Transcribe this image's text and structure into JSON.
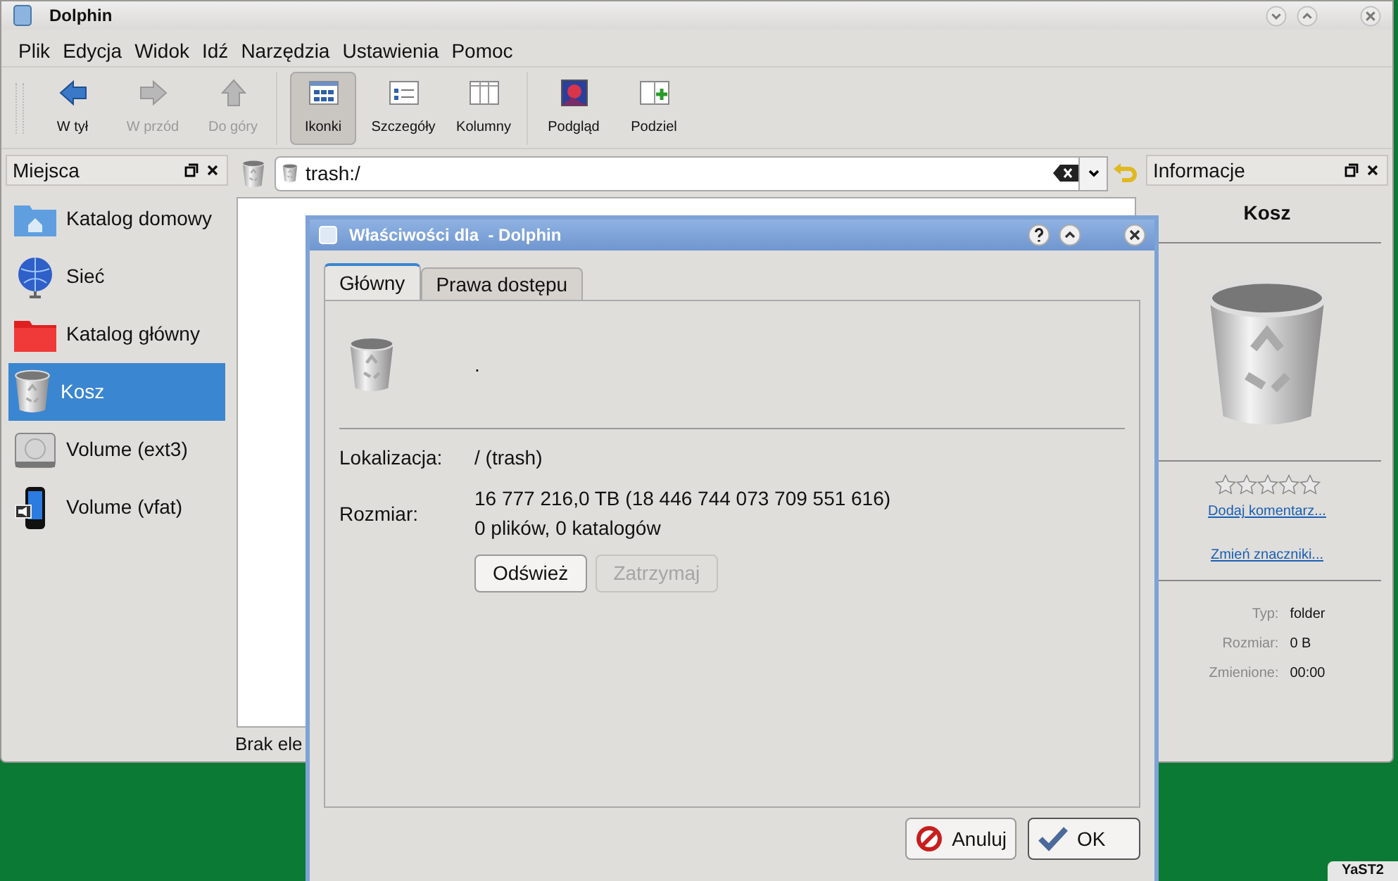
{
  "window": {
    "title": "Dolphin"
  },
  "menu": [
    "Plik",
    "Edycja",
    "Widok",
    "Idź",
    "Narzędzia",
    "Ustawienia",
    "Pomoc"
  ],
  "toolbar": [
    [
      {
        "label": "W tył",
        "kind": "back",
        "disabled": false,
        "selected": false
      },
      {
        "label": "W przód",
        "kind": "forward",
        "disabled": true,
        "selected": false
      },
      {
        "label": "Do góry",
        "kind": "up",
        "disabled": true,
        "selected": false
      }
    ],
    [
      {
        "label": "Ikonki",
        "kind": "icons",
        "disabled": false,
        "selected": true
      },
      {
        "label": "Szczegóły",
        "kind": "details",
        "disabled": false,
        "selected": false
      },
      {
        "label": "Kolumny",
        "kind": "columns",
        "disabled": false,
        "selected": false
      }
    ],
    [
      {
        "label": "Podgląd",
        "kind": "preview",
        "disabled": false,
        "selected": false
      },
      {
        "label": "Podziel",
        "kind": "split",
        "disabled": false,
        "selected": false
      }
    ]
  ],
  "places": {
    "title": "Miejsca",
    "items": [
      {
        "label": "Katalog domowy",
        "kind": "home",
        "selected": false
      },
      {
        "label": "Sieć",
        "kind": "network",
        "selected": false
      },
      {
        "label": "Katalog główny",
        "kind": "root",
        "selected": false
      },
      {
        "label": "Kosz",
        "kind": "trash",
        "selected": true
      },
      {
        "label": "Volume (ext3)",
        "kind": "disk",
        "selected": false
      },
      {
        "label": "Volume (vfat)",
        "kind": "phone",
        "selected": false
      }
    ]
  },
  "location": {
    "value": "trash:/"
  },
  "status": "Brak ele",
  "info": {
    "title": "Informacje",
    "name": "Kosz",
    "stars": 0,
    "links": [
      "Dodaj komentarz...",
      "Zmień znaczniki..."
    ],
    "fields": [
      {
        "label": "Typ:",
        "value": "folder"
      },
      {
        "label": "Rozmiar:",
        "value": "0 B"
      },
      {
        "label": "Zmienione:",
        "value": "00:00"
      }
    ]
  },
  "dialog": {
    "title": "Właściwości dla  - Dolphin",
    "tabs": [
      {
        "label": "Główny",
        "selected": true
      },
      {
        "label": "Prawa dostępu",
        "selected": false
      }
    ],
    "name": ".",
    "fields": [
      {
        "label": "Lokalizacja:",
        "lines": [
          "/ (trash)"
        ]
      },
      {
        "label": "Rozmiar:",
        "lines": [
          "16 777 216,0 TB (18 446 744 073 709 551 616)",
          "0 plików, 0 katalogów"
        ]
      }
    ],
    "actions": [
      {
        "label": "Odśwież",
        "disabled": false
      },
      {
        "label": "Zatrzymaj",
        "disabled": true
      }
    ],
    "buttons": [
      {
        "label": "Anuluj",
        "kind": "cancel"
      },
      {
        "label": "OK",
        "kind": "ok"
      }
    ]
  },
  "taskbar": [
    {
      "label": "YaST2"
    }
  ]
}
